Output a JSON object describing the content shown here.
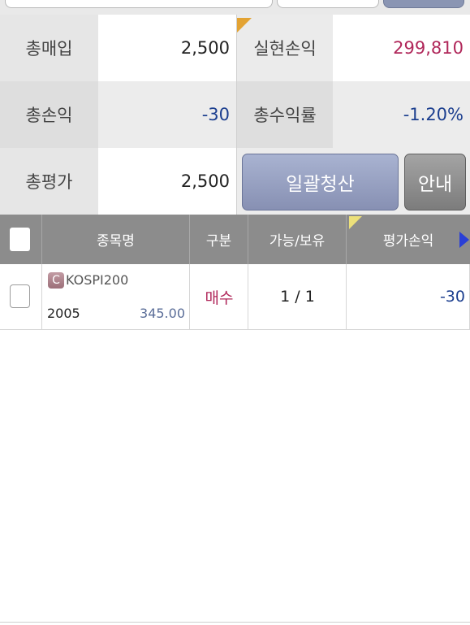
{
  "summary": {
    "total_buy_label": "총매입",
    "total_buy_value": "2,500",
    "realized_pl_label": "실현손익",
    "realized_pl_value": "299,810",
    "total_pl_label": "총손익",
    "total_pl_value": "-30",
    "total_return_label": "총수익률",
    "total_return_value": "-1.20%",
    "total_eval_label": "총평가",
    "total_eval_value": "2,500"
  },
  "buttons": {
    "bulk_liquidate": "일괄청산",
    "info": "안내"
  },
  "table": {
    "headers": [
      "종목명",
      "구분",
      "가능/보유",
      "평가손익"
    ],
    "rows": [
      {
        "badge": "C",
        "name": "KOSPI200",
        "code": "2005",
        "price": "345.00",
        "side": "매수",
        "qty": "1 / 1",
        "pl": "-30"
      }
    ]
  },
  "colors": {
    "positive": "#b0275a",
    "negative": "#1c3f8f",
    "header_bg": "#8c8c8c",
    "button_blue": "#8790b3"
  }
}
